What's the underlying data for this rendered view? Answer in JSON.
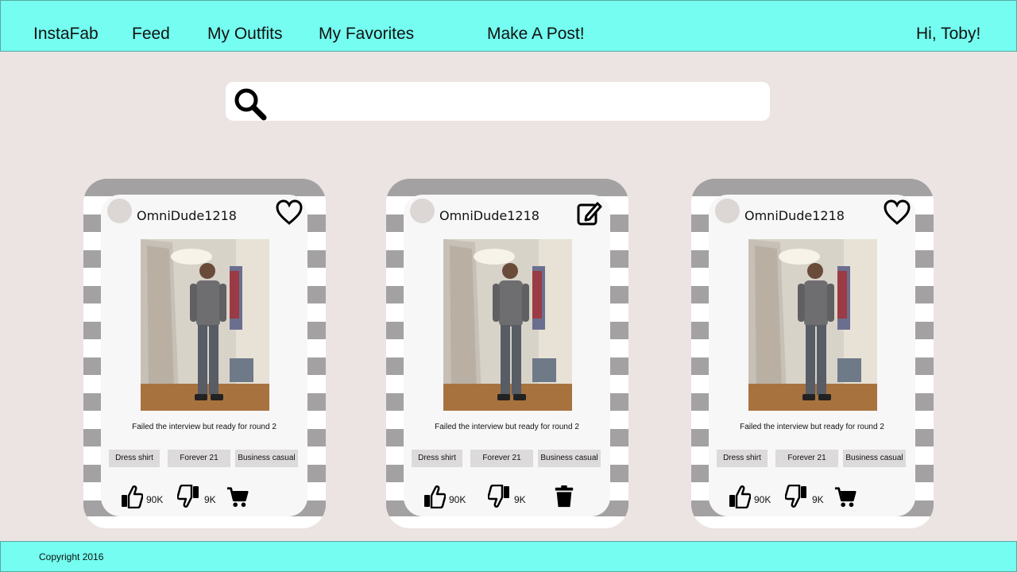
{
  "nav": {
    "brand": "InstaFab",
    "feed": "Feed",
    "my_outfits": "My Outfits",
    "my_favorites": "My Favorites",
    "make_post": "Make A Post!",
    "greeting": "Hi, Toby!"
  },
  "search": {
    "value": "",
    "placeholder": "",
    "icon": "search-icon"
  },
  "posts": [
    {
      "username": "OmniDude1218",
      "action_icon": "heart-outline-icon",
      "caption": "Failed the interview but ready for round 2",
      "tags": [
        "Dress shirt",
        "Forever 21",
        "Business casual"
      ],
      "likes": "90K",
      "dislikes": "9K",
      "bottom_action": "cart-icon"
    },
    {
      "username": "OmniDude1218",
      "action_icon": "edit-icon",
      "caption": "Failed the interview but ready for round 2",
      "tags": [
        "Dress shirt",
        "Forever 21",
        "Business casual"
      ],
      "likes": "90K",
      "dislikes": "9K",
      "bottom_action": "trash-icon"
    },
    {
      "username": "OmniDude1218",
      "action_icon": "heart-outline-icon",
      "caption": "Failed the interview but ready for round 2",
      "tags": [
        "Dress shirt",
        "Forever 21",
        "Business casual"
      ],
      "likes": "90K",
      "dislikes": "9K",
      "bottom_action": "cart-icon"
    }
  ],
  "footer": {
    "copyright": "Copyright 2016"
  },
  "colors": {
    "header_bg": "#74fdf0",
    "page_bg": "#ece4e3",
    "card_stripe": "#a3a1a1",
    "card_inner": "#f7f7f7",
    "tag_bg": "#dcdada"
  }
}
